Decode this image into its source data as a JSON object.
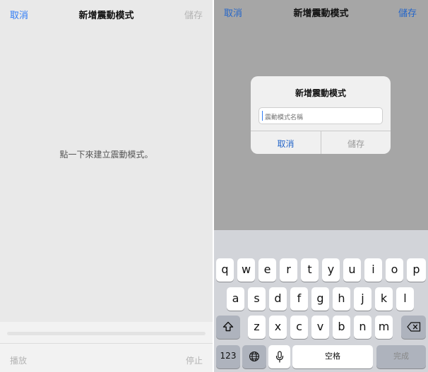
{
  "left": {
    "nav": {
      "cancel": "取消",
      "title": "新增震動模式",
      "save": "儲存"
    },
    "hint": "點一下來建立震動模式。",
    "toolbar": {
      "play": "播放",
      "stop": "停止"
    }
  },
  "right": {
    "nav": {
      "cancel": "取消",
      "title": "新增震動模式",
      "save": "儲存"
    },
    "alert": {
      "title": "新增震動模式",
      "placeholder": "震動模式名稱",
      "cancel": "取消",
      "save": "儲存"
    },
    "keyboard": {
      "row1": [
        "q",
        "w",
        "e",
        "r",
        "t",
        "y",
        "u",
        "i",
        "o",
        "p"
      ],
      "row2": [
        "a",
        "s",
        "d",
        "f",
        "g",
        "h",
        "j",
        "k",
        "l"
      ],
      "row3": [
        "z",
        "x",
        "c",
        "v",
        "b",
        "n",
        "m"
      ],
      "numbers_key": "123",
      "space_key": "空格",
      "done_key": "完成",
      "icons": {
        "shift": "shift-icon",
        "delete": "delete-icon",
        "globe": "globe-icon",
        "mic": "mic-icon"
      }
    }
  },
  "colors": {
    "accent": "#2f7cf6",
    "disabled": "#b4b4b4"
  }
}
